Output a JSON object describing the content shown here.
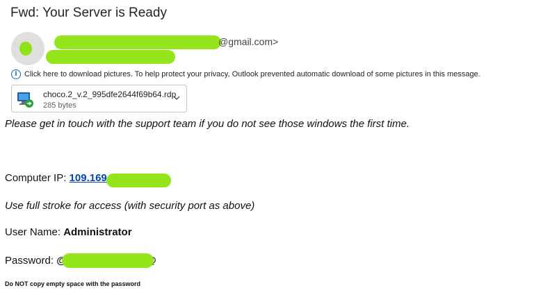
{
  "email": {
    "subject": "Fwd: Your Server is Ready",
    "sender_email_suffix": "@gmail.com>",
    "info_bar_text": "Click here to download pictures. To help protect your privacy, Outlook prevented automatic download of some pictures in this message.",
    "info_icon": "info-icon",
    "redaction_color": "#94e51c"
  },
  "attachment": {
    "filename": "choco.2_v.2_995dfe2644f69b64.rdp",
    "size": "285 bytes",
    "icon": "remote-desktop-icon"
  },
  "body": {
    "intro": "Please get in touch with the support team if you do not see those windows the first time.",
    "ip_label": "Computer IP: ",
    "ip_value": "109.169",
    "stroke_note": "Use full stroke for access (with security port as above)",
    "username_label": "User Name: ",
    "username_value": "Administrator",
    "password_label": "Password: ",
    "password_start": "@",
    "password_end": "@",
    "copy_note": "Do NOT copy empty space with the password"
  }
}
